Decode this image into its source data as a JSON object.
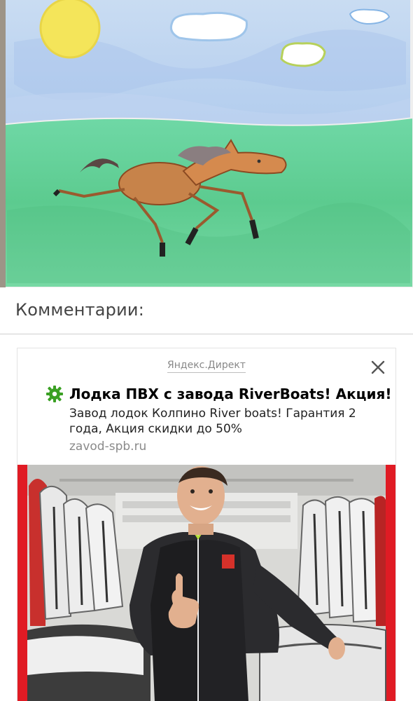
{
  "artwork": {
    "alt_subject": "child drawing of a horse on grass under blue sky with sun and clouds"
  },
  "comments": {
    "title": "Комментарии:"
  },
  "ad": {
    "source_label": "Яндекс.Директ",
    "title": "Лодка ПВХ с завода RiverBoats! Акция!",
    "text": "Завод лодок Колпино River boats! Гарантия 2 года, Акция скидки до 50%",
    "domain": "zavod-spb.ru",
    "favicon_icon": "gear-icon",
    "close_icon": "close-icon",
    "favicon_color": "#3aa023",
    "accent_red": "#e01b24"
  }
}
